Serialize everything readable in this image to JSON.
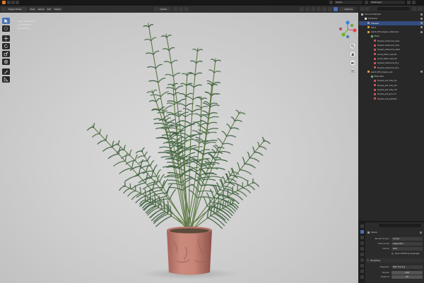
{
  "topbar": {
    "scene_label": "Scene",
    "view_layer_label": "ViewLayer"
  },
  "viewport": {
    "mode_label": "Object Mode",
    "menus": [
      "View",
      "Select",
      "Add",
      "Object"
    ],
    "transform_orientation": "Global",
    "options_label": "Options",
    "overlay_lines": [
      "User Perspective",
      "(1) Collection",
      "Areca Palm"
    ]
  },
  "outliner": {
    "search_placeholder": "",
    "rows": [
      {
        "label": "Scene Collection",
        "depth": 0,
        "icon_color": "#b0b0b0",
        "selected": false
      },
      {
        "label": "Collection",
        "depth": 1,
        "icon_color": "#e0e0e0",
        "selected": false
      },
      {
        "label": "Camera",
        "depth": 2,
        "icon_color": "#9c9c9c",
        "selected": true
      },
      {
        "label": "Rotor",
        "depth": 2,
        "icon_color": "#e0a040",
        "selected": false
      },
      {
        "label": "plant_005_Dypsis_lutescens",
        "depth": 2,
        "icon_color": "#e0a040",
        "selected": false
      },
      {
        "label": "Mesh",
        "depth": 3,
        "icon_color": "#6fb06f",
        "selected": false
      },
      {
        "label": "Dypsis_lutescens_leav",
        "depth": 4,
        "icon_color": "#c55a5a",
        "selected": false
      },
      {
        "label": "Dypsis_lutescens_leav",
        "depth": 4,
        "icon_color": "#c55a5a",
        "selected": false
      },
      {
        "label": "Dypsis_lutescens_stem",
        "depth": 4,
        "icon_color": "#c55a5a",
        "selected": false
      },
      {
        "label": "Areca_Palm_leaf_01",
        "depth": 4,
        "icon_color": "#c55a5a",
        "selected": false
      },
      {
        "label": "Areca_Palm_leaf_02",
        "depth": 4,
        "icon_color": "#c55a5a",
        "selected": false
      },
      {
        "label": "Dypsis_lutescens_Dry",
        "depth": 4,
        "icon_color": "#c55a5a",
        "selected": false
      },
      {
        "label": "Dypsis_lutescens_Dry",
        "depth": 4,
        "icon_color": "#c55a5a",
        "selected": false
      },
      {
        "label": "plant_005_Dypsis_pot",
        "depth": 2,
        "icon_color": "#e0a040",
        "selected": false
      },
      {
        "label": "Mesh.001",
        "depth": 3,
        "icon_color": "#6fb06f",
        "selected": false
      },
      {
        "label": "Dypsis_pot_Clay_01",
        "depth": 4,
        "icon_color": "#c55a5a",
        "selected": false
      },
      {
        "label": "Dypsis_pot_Clay_02",
        "depth": 4,
        "icon_color": "#c55a5a",
        "selected": false
      },
      {
        "label": "Dypsis_pot_Clay_03",
        "depth": 4,
        "icon_color": "#c55a5a",
        "selected": false
      },
      {
        "label": "Dypsis_pot_ground",
        "depth": 4,
        "icon_color": "#c55a5a",
        "selected": false
      },
      {
        "label": "Dypsis_pot_pebbles",
        "depth": 4,
        "icon_color": "#c55a5a",
        "selected": false
      }
    ]
  },
  "properties": {
    "header": "Scene",
    "render_engine_label": "Render Engine",
    "render_engine_value": "Cycles",
    "feature_set_label": "Feature Set",
    "feature_set_value": "Supported",
    "device_label": "Device",
    "device_value": "GPU",
    "osl_label": "Open Shading Language",
    "sampling_label": "Sampling",
    "integrator_label": "Integrator",
    "integrator_value": "Path Tracing",
    "render_label": "Render",
    "render_value": "128",
    "viewport_label": "Viewport",
    "viewport_value": "32"
  },
  "colors": {
    "accent": "#4772b3",
    "selected_row": "#334d80",
    "viewport_bg": "#cfcfcf",
    "panel_bg": "#282828"
  }
}
